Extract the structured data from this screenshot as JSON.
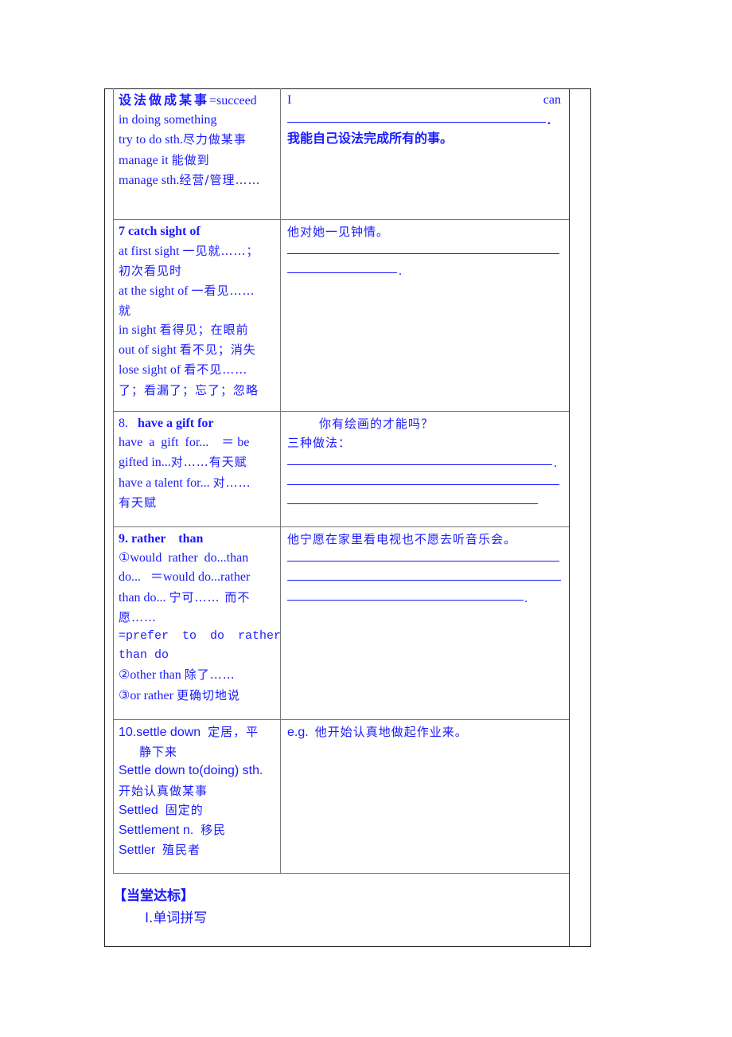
{
  "rows": [
    {
      "left": {
        "title_zh": "设法做成某事",
        "title_en": "=succeed",
        "line2": "in doing  something",
        "line3_en": "try to do sth.",
        "line3_zh": "尽力做某事",
        "line4_en": "manage it ",
        "line4_zh": "能做到",
        "line5_en": "manage sth.",
        "line5_zh": "经营/管理……"
      },
      "right": {
        "word1": "I",
        "word2": "can",
        "period": ".",
        "translation": "我能自己设法完成所有的事。"
      }
    },
    {
      "left": {
        "title": "7 catch sight of",
        "l1_en": "at first sight ",
        "l1_zh": "一见就……；",
        "l2_zh": "初次看见时",
        "l3_en": "at the sight of ",
        "l3_zh": "一看见……",
        "l4_zh": "就",
        "l5_en": "in sight ",
        "l5_zh": "看得见；在眼前",
        "l6_en": "out of sight ",
        "l6_zh": "看不见；消失",
        "l7_en": "lose sight of  ",
        "l7_zh": "看不见……",
        "l8_zh": "了；看漏了；忘了；忽略"
      },
      "right": {
        "prompt": "他对她一见钟情。",
        "period": "."
      }
    },
    {
      "left": {
        "title_num": "8.",
        "title": "have a gift for",
        "l1": "have  a  gift  for...    ＝ be",
        "l2_en": "gifted in...",
        "l2_zh": "对……有天赋",
        "l3_en": "have a talent for... ",
        "l3_zh": "对……",
        "l4_zh": "有天赋"
      },
      "right": {
        "prompt": "你有绘画的才能吗？",
        "method_label": "三种做法：",
        "period": "."
      }
    },
    {
      "left": {
        "title": "9. rather    than",
        "l1": "①would  rather  do...than",
        "l2": "do...   ＝would do...rather",
        "l3_en": "than do... ",
        "l3_zh": "宁可…… 而不",
        "l4_zh": "愿……",
        "l5": "=prefer to do rather",
        "l6": "than do",
        "l7_en": "②other than ",
        "l7_zh": "除了……",
        "l8_en": "③or rather ",
        "l8_zh": "更确切地说"
      },
      "right": {
        "prompt": "他宁愿在家里看电视也不愿去听音乐会。",
        "period": "."
      }
    },
    {
      "left": {
        "l1_en": "10.settle down  ",
        "l1_zh": "定居，平",
        "l2_zh": "静下来",
        "l3": "Settle down to(doing) sth.",
        "l4_zh": "开始认真做某事",
        "l5_en": "Settled  ",
        "l5_zh": "固定的",
        "l6_en": "Settlement n.  ",
        "l6_zh": "移民",
        "l7_en": "Settler  ",
        "l7_zh": "殖民者"
      },
      "right": {
        "eg_label": "e.g.",
        "prompt": "他开始认真地做起作业来。"
      }
    }
  ],
  "footer": {
    "section_title": "【当堂达标】",
    "subsection": "Ⅰ.单词拼写"
  },
  "colors": {
    "text": "#1a1aff",
    "border": "#222222"
  }
}
